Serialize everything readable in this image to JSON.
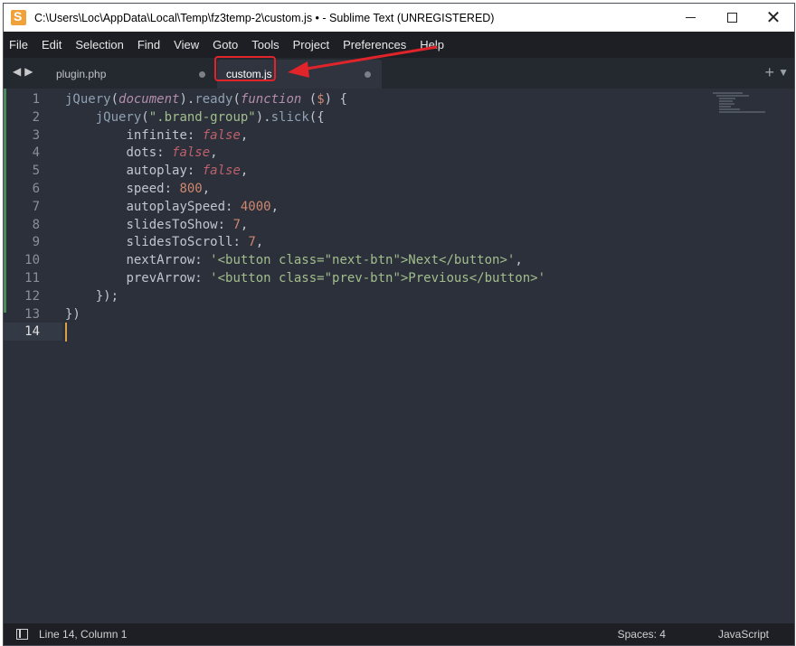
{
  "window": {
    "title": "C:\\Users\\Loc\\AppData\\Local\\Temp\\fz3temp-2\\custom.js • - Sublime Text (UNREGISTERED)",
    "minimize_icon": "minimize-icon",
    "maximize_icon": "maximize-icon",
    "close_label": "✕"
  },
  "menu": {
    "items": [
      "File",
      "Edit",
      "Selection",
      "Find",
      "View",
      "Goto",
      "Tools",
      "Project",
      "Preferences",
      "Help"
    ]
  },
  "tabs": {
    "nav_arrows": "◀▶",
    "items": [
      {
        "label": "plugin.php",
        "active": false,
        "modified": true
      },
      {
        "label": "custom.js",
        "active": true,
        "modified": true
      }
    ],
    "add_label": "+",
    "dropdown_label": "▼"
  },
  "editor": {
    "line_numbers": [
      "1",
      "2",
      "3",
      "4",
      "5",
      "6",
      "7",
      "8",
      "9",
      "10",
      "11",
      "12",
      "13",
      "14"
    ],
    "current_line": 14,
    "lines": [
      [
        [
          "fn",
          "jQuery"
        ],
        [
          "punc",
          "("
        ],
        [
          "it",
          "document"
        ],
        [
          "punc",
          ")."
        ],
        [
          "fn",
          "ready"
        ],
        [
          "punc",
          "("
        ],
        [
          "kw",
          "function"
        ],
        [
          "punc",
          " ("
        ],
        [
          "dollar",
          "$"
        ],
        [
          "punc",
          ") {"
        ]
      ],
      [
        [
          "punc",
          "    "
        ],
        [
          "fn",
          "jQuery"
        ],
        [
          "punc",
          "("
        ],
        [
          "str",
          "\".brand-group\""
        ],
        [
          "punc",
          ")."
        ],
        [
          "fn",
          "slick"
        ],
        [
          "punc",
          "({"
        ]
      ],
      [
        [
          "punc",
          "        "
        ],
        [
          "key",
          "infinite"
        ],
        [
          "punc",
          ": "
        ],
        [
          "bool",
          "false"
        ],
        [
          "punc",
          ","
        ]
      ],
      [
        [
          "punc",
          "        "
        ],
        [
          "key",
          "dots"
        ],
        [
          "punc",
          ": "
        ],
        [
          "bool",
          "false"
        ],
        [
          "punc",
          ","
        ]
      ],
      [
        [
          "punc",
          "        "
        ],
        [
          "key",
          "autoplay"
        ],
        [
          "punc",
          ": "
        ],
        [
          "bool",
          "false"
        ],
        [
          "punc",
          ","
        ]
      ],
      [
        [
          "punc",
          "        "
        ],
        [
          "key",
          "speed"
        ],
        [
          "punc",
          ": "
        ],
        [
          "num",
          "800"
        ],
        [
          "punc",
          ","
        ]
      ],
      [
        [
          "punc",
          "        "
        ],
        [
          "key",
          "autoplaySpeed"
        ],
        [
          "punc",
          ": "
        ],
        [
          "num",
          "4000"
        ],
        [
          "punc",
          ","
        ]
      ],
      [
        [
          "punc",
          "        "
        ],
        [
          "key",
          "slidesToShow"
        ],
        [
          "punc",
          ": "
        ],
        [
          "num",
          "7"
        ],
        [
          "punc",
          ","
        ]
      ],
      [
        [
          "punc",
          "        "
        ],
        [
          "key",
          "slidesToScroll"
        ],
        [
          "punc",
          ": "
        ],
        [
          "num",
          "7"
        ],
        [
          "punc",
          ","
        ]
      ],
      [
        [
          "punc",
          "        "
        ],
        [
          "key",
          "nextArrow"
        ],
        [
          "punc",
          ": "
        ],
        [
          "str",
          "'<button class=\"next-btn\">Next</button>'"
        ],
        [
          "punc",
          ","
        ]
      ],
      [
        [
          "punc",
          "        "
        ],
        [
          "key",
          "prevArrow"
        ],
        [
          "punc",
          ": "
        ],
        [
          "str",
          "'<button class=\"prev-btn\">Previous</button>'"
        ]
      ],
      [
        [
          "punc",
          "    });"
        ]
      ],
      [
        [
          "punc",
          "})"
        ]
      ],
      []
    ]
  },
  "statusbar": {
    "position": "Line 14, Column 1",
    "spaces": "Spaces: 4",
    "syntax": "JavaScript"
  },
  "colors": {
    "annotation_red": "#e0242a",
    "editor_bg": "#2b303b"
  }
}
